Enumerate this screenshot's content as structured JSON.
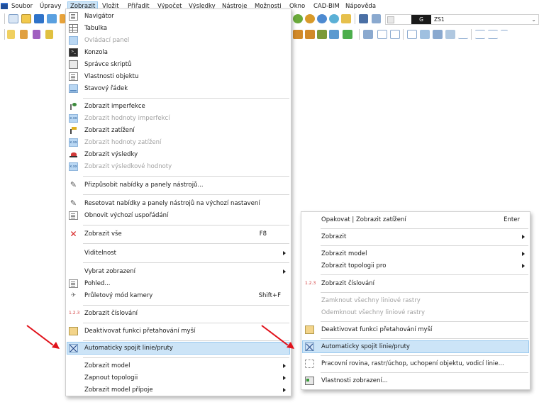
{
  "menubar": {
    "items": [
      {
        "label": "Soubor"
      },
      {
        "label": "Úpravy"
      },
      {
        "label": "Zobrazit"
      },
      {
        "label": "Vložit"
      },
      {
        "label": "Přiřadit"
      },
      {
        "label": "Výpočet"
      },
      {
        "label": "Výsledky"
      },
      {
        "label": "Nástroje"
      },
      {
        "label": "Možnosti"
      },
      {
        "label": "Okno"
      },
      {
        "label": "CAD-BIM"
      },
      {
        "label": "Nápověda"
      }
    ],
    "active_item": "Zobrazit"
  },
  "toolbar": {
    "combo_g": "G",
    "combo_value": "ZS1",
    "combo_arrow": "⌄"
  },
  "view_menu": {
    "items": [
      {
        "label": "Navigátor",
        "icon": "navigator-icon"
      },
      {
        "label": "Tabulka",
        "icon": "table-icon"
      },
      {
        "label": "Ovládací panel",
        "icon": "control-panel-icon",
        "disabled": true
      },
      {
        "label": "Konzola",
        "icon": "console-icon"
      },
      {
        "label": "Správce skriptů",
        "icon": "script-manager-icon"
      },
      {
        "label": "Vlastnosti objektu",
        "icon": "object-properties-icon"
      },
      {
        "label": "Stavový řádek",
        "icon": "status-bar-icon"
      },
      {
        "label": "Zobrazit imperfekce",
        "icon": "imperfection-icon"
      },
      {
        "label": "Zobrazit hodnoty imperfekcí",
        "icon": "imperfection-values-icon",
        "disabled": true
      },
      {
        "label": "Zobrazit zatížení",
        "icon": "load-icon"
      },
      {
        "label": "Zobrazit hodnoty zatížení",
        "icon": "load-values-icon",
        "disabled": true
      },
      {
        "label": "Zobrazit výsledky",
        "icon": "results-icon"
      },
      {
        "label": "Zobrazit výsledkové hodnoty",
        "icon": "result-values-icon",
        "disabled": true
      },
      {
        "label": "Přizpůsobit nabídky a panely nástrojů...",
        "icon": "customize-tools-icon"
      },
      {
        "label": "Resetovat nabídky a panely nástrojů na výchozí nastavení",
        "icon": "reset-tools-icon"
      },
      {
        "label": "Obnovit výchozí uspořádání",
        "icon": "restore-layout-icon"
      },
      {
        "label": "Zobrazit vše",
        "icon": "show-all-icon",
        "shortcut": "F8"
      },
      {
        "label": "Viditelnost",
        "submenu": true
      },
      {
        "label": "Vybrat zobrazení",
        "submenu": true
      },
      {
        "label": "Pohled...",
        "icon": "view-icon"
      },
      {
        "label": "Průletový mód kamery",
        "icon": "camera-flight-icon",
        "shortcut": "Shift+F"
      },
      {
        "label": "Zobrazit číslování",
        "icon": "numbering-icon"
      },
      {
        "label": "Deaktivovat funkci přetahování myší",
        "icon": "mouse-drag-icon"
      },
      {
        "label": "Automaticky spojit linie/pruty",
        "icon": "auto-connect-icon",
        "highlighted": true
      },
      {
        "label": "Zobrazit model",
        "submenu": true
      },
      {
        "label": "Zapnout topologii",
        "submenu": true
      },
      {
        "label": "Zobrazit model přípoje",
        "submenu": true
      }
    ]
  },
  "context_menu": {
    "items": [
      {
        "label": "Opakovat | Zobrazit zatížení",
        "shortcut": "Enter"
      },
      {
        "label": "Zobrazit",
        "submenu": true
      },
      {
        "label": "Zobrazit model",
        "submenu": true
      },
      {
        "label": "Zobrazit topologii pro",
        "submenu": true
      },
      {
        "label": "Zobrazit číslování",
        "icon": "numbering-icon"
      },
      {
        "label": "Zamknout všechny liniové rastry",
        "disabled": true
      },
      {
        "label": "Odemknout všechny liniové rastry",
        "disabled": true
      },
      {
        "label": "Deaktivovat funkci přetahování myší",
        "icon": "mouse-drag-icon"
      },
      {
        "label": "Automaticky spojit linie/pruty",
        "icon": "auto-connect-icon",
        "highlighted": true
      },
      {
        "label": "Pracovní rovina, rastr/úchop, uchopení objektu, vodicí linie...",
        "icon": "work-plane-icon"
      },
      {
        "label": "Vlastnosti zobrazení...",
        "icon": "display-properties-icon"
      }
    ]
  },
  "colors": {
    "highlight_bg": "#cce4f7",
    "highlight_border": "#99c9ef",
    "annotation_arrow": "#e1121b",
    "disabled_text": "#a0a0a0"
  }
}
